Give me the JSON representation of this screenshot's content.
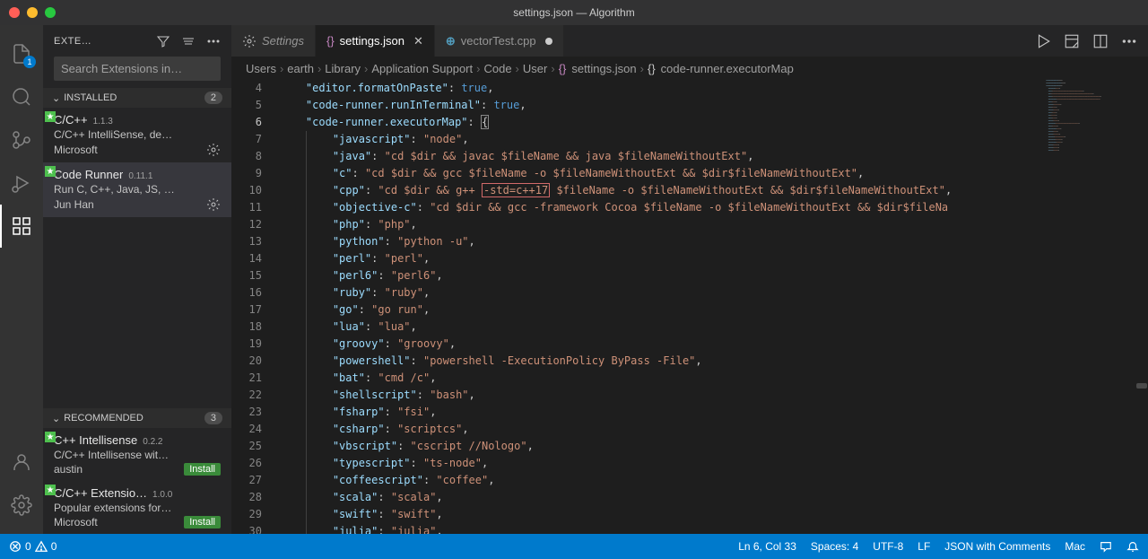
{
  "window": {
    "title": "settings.json — Algorithm"
  },
  "sidebar": {
    "title": "EXTE…",
    "search_placeholder": "Search Extensions in…",
    "installed_label": "INSTALLED",
    "installed_count": "2",
    "recommended_label": "RECOMMENDED",
    "recommended_count": "3",
    "installed": [
      {
        "name": "C/C++",
        "version": "1.1.3",
        "desc": "C/C++ IntelliSense, de…",
        "publisher": "Microsoft"
      },
      {
        "name": "Code Runner",
        "version": "0.11.1",
        "desc": "Run C, C++, Java, JS, …",
        "publisher": "Jun Han"
      }
    ],
    "recommended": [
      {
        "name": "C++ Intellisense",
        "version": "0.2.2",
        "desc": "C/C++ Intellisense wit…",
        "publisher": "austin",
        "action": "Install"
      },
      {
        "name": "C/C++ Extensio…",
        "version": "1.0.0",
        "desc": "Popular extensions for…",
        "publisher": "Microsoft",
        "action": "Install"
      }
    ]
  },
  "tabs": {
    "settings": "Settings",
    "file1": "settings.json",
    "file2": "vectorTest.cpp"
  },
  "breadcrumbs": {
    "p0": "Users",
    "p1": "earth",
    "p2": "Library",
    "p3": "Application Support",
    "p4": "Code",
    "p5": "User",
    "p6": "settings.json",
    "p7": "code-runner.executorMap"
  },
  "code": {
    "first_line": 4,
    "current_line": 6,
    "lines": [
      {
        "n": 4,
        "segs": [
          [
            "k",
            "\"editor.formatOnPaste\""
          ],
          [
            "p",
            ": "
          ],
          [
            "b",
            "true"
          ],
          [
            "p",
            ","
          ]
        ]
      },
      {
        "n": 5,
        "segs": [
          [
            "k",
            "\"code-runner.runInTerminal\""
          ],
          [
            "p",
            ": "
          ],
          [
            "b",
            "true"
          ],
          [
            "p",
            ","
          ]
        ]
      },
      {
        "n": 6,
        "segs": [
          [
            "k",
            "\"code-runner.executorMap\""
          ],
          [
            "p",
            ": "
          ],
          [
            "cursor",
            "{"
          ]
        ]
      },
      {
        "n": 7,
        "indent": 1,
        "segs": [
          [
            "k",
            "\"javascript\""
          ],
          [
            "p",
            ": "
          ],
          [
            "s",
            "\"node\""
          ],
          [
            "p",
            ","
          ]
        ]
      },
      {
        "n": 8,
        "indent": 1,
        "segs": [
          [
            "k",
            "\"java\""
          ],
          [
            "p",
            ": "
          ],
          [
            "s",
            "\"cd $dir && javac $fileName && java $fileNameWithoutExt\""
          ],
          [
            "p",
            ","
          ]
        ]
      },
      {
        "n": 9,
        "indent": 1,
        "segs": [
          [
            "k",
            "\"c\""
          ],
          [
            "p",
            ": "
          ],
          [
            "s",
            "\"cd $dir && gcc $fileName -o $fileNameWithoutExt && $dir$fileNameWithoutExt\""
          ],
          [
            "p",
            ","
          ]
        ]
      },
      {
        "n": 10,
        "indent": 1,
        "segs": [
          [
            "k",
            "\"cpp\""
          ],
          [
            "p",
            ": "
          ],
          [
            "s",
            "\"cd $dir && g++ "
          ],
          [
            "hl",
            "-std=c++17"
          ],
          [
            "s",
            " $fileName -o $fileNameWithoutExt && $dir$fileNameWithoutExt\""
          ],
          [
            "p",
            ","
          ]
        ]
      },
      {
        "n": 11,
        "indent": 1,
        "segs": [
          [
            "k",
            "\"objective-c\""
          ],
          [
            "p",
            ": "
          ],
          [
            "s",
            "\"cd $dir && gcc -framework Cocoa $fileName -o $fileNameWithoutExt && $dir$fileNa"
          ]
        ]
      },
      {
        "n": 12,
        "indent": 1,
        "segs": [
          [
            "k",
            "\"php\""
          ],
          [
            "p",
            ": "
          ],
          [
            "s",
            "\"php\""
          ],
          [
            "p",
            ","
          ]
        ]
      },
      {
        "n": 13,
        "indent": 1,
        "segs": [
          [
            "k",
            "\"python\""
          ],
          [
            "p",
            ": "
          ],
          [
            "s",
            "\"python -u\""
          ],
          [
            "p",
            ","
          ]
        ]
      },
      {
        "n": 14,
        "indent": 1,
        "segs": [
          [
            "k",
            "\"perl\""
          ],
          [
            "p",
            ": "
          ],
          [
            "s",
            "\"perl\""
          ],
          [
            "p",
            ","
          ]
        ]
      },
      {
        "n": 15,
        "indent": 1,
        "segs": [
          [
            "k",
            "\"perl6\""
          ],
          [
            "p",
            ": "
          ],
          [
            "s",
            "\"perl6\""
          ],
          [
            "p",
            ","
          ]
        ]
      },
      {
        "n": 16,
        "indent": 1,
        "segs": [
          [
            "k",
            "\"ruby\""
          ],
          [
            "p",
            ": "
          ],
          [
            "s",
            "\"ruby\""
          ],
          [
            "p",
            ","
          ]
        ]
      },
      {
        "n": 17,
        "indent": 1,
        "segs": [
          [
            "k",
            "\"go\""
          ],
          [
            "p",
            ": "
          ],
          [
            "s",
            "\"go run\""
          ],
          [
            "p",
            ","
          ]
        ]
      },
      {
        "n": 18,
        "indent": 1,
        "segs": [
          [
            "k",
            "\"lua\""
          ],
          [
            "p",
            ": "
          ],
          [
            "s",
            "\"lua\""
          ],
          [
            "p",
            ","
          ]
        ]
      },
      {
        "n": 19,
        "indent": 1,
        "segs": [
          [
            "k",
            "\"groovy\""
          ],
          [
            "p",
            ": "
          ],
          [
            "s",
            "\"groovy\""
          ],
          [
            "p",
            ","
          ]
        ]
      },
      {
        "n": 20,
        "indent": 1,
        "segs": [
          [
            "k",
            "\"powershell\""
          ],
          [
            "p",
            ": "
          ],
          [
            "s",
            "\"powershell -ExecutionPolicy ByPass -File\""
          ],
          [
            "p",
            ","
          ]
        ]
      },
      {
        "n": 21,
        "indent": 1,
        "segs": [
          [
            "k",
            "\"bat\""
          ],
          [
            "p",
            ": "
          ],
          [
            "s",
            "\"cmd /c\""
          ],
          [
            "p",
            ","
          ]
        ]
      },
      {
        "n": 22,
        "indent": 1,
        "segs": [
          [
            "k",
            "\"shellscript\""
          ],
          [
            "p",
            ": "
          ],
          [
            "s",
            "\"bash\""
          ],
          [
            "p",
            ","
          ]
        ]
      },
      {
        "n": 23,
        "indent": 1,
        "segs": [
          [
            "k",
            "\"fsharp\""
          ],
          [
            "p",
            ": "
          ],
          [
            "s",
            "\"fsi\""
          ],
          [
            "p",
            ","
          ]
        ]
      },
      {
        "n": 24,
        "indent": 1,
        "segs": [
          [
            "k",
            "\"csharp\""
          ],
          [
            "p",
            ": "
          ],
          [
            "s",
            "\"scriptcs\""
          ],
          [
            "p",
            ","
          ]
        ]
      },
      {
        "n": 25,
        "indent": 1,
        "segs": [
          [
            "k",
            "\"vbscript\""
          ],
          [
            "p",
            ": "
          ],
          [
            "s",
            "\"cscript //Nologo\""
          ],
          [
            "p",
            ","
          ]
        ]
      },
      {
        "n": 26,
        "indent": 1,
        "segs": [
          [
            "k",
            "\"typescript\""
          ],
          [
            "p",
            ": "
          ],
          [
            "s",
            "\"ts-node\""
          ],
          [
            "p",
            ","
          ]
        ]
      },
      {
        "n": 27,
        "indent": 1,
        "segs": [
          [
            "k",
            "\"coffeescript\""
          ],
          [
            "p",
            ": "
          ],
          [
            "s",
            "\"coffee\""
          ],
          [
            "p",
            ","
          ]
        ]
      },
      {
        "n": 28,
        "indent": 1,
        "segs": [
          [
            "k",
            "\"scala\""
          ],
          [
            "p",
            ": "
          ],
          [
            "s",
            "\"scala\""
          ],
          [
            "p",
            ","
          ]
        ]
      },
      {
        "n": 29,
        "indent": 1,
        "segs": [
          [
            "k",
            "\"swift\""
          ],
          [
            "p",
            ": "
          ],
          [
            "s",
            "\"swift\""
          ],
          [
            "p",
            ","
          ]
        ]
      },
      {
        "n": 30,
        "indent": 1,
        "segs": [
          [
            "k",
            "\"julia\""
          ],
          [
            "p",
            ": "
          ],
          [
            "s",
            "\"julia\""
          ],
          [
            "p",
            ","
          ]
        ]
      }
    ]
  },
  "statusbar": {
    "errors": "0",
    "warnings": "0",
    "cursor": "Ln 6, Col 33",
    "spaces": "Spaces: 4",
    "encoding": "UTF-8",
    "eol": "LF",
    "lang": "JSON with Comments",
    "os": "Mac"
  },
  "activity": {
    "explorer_badge": "1"
  }
}
